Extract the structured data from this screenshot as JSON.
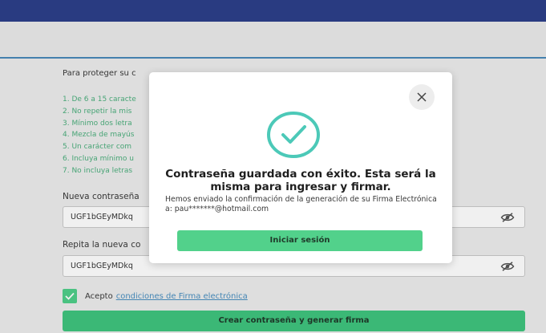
{
  "form": {
    "intro": "Para proteger su c",
    "rules": [
      "1. De 6 a 15 caracte",
      "2. No repetir la mis",
      "3. Mínimo dos letra",
      "4. Mezcla de mayús",
      "5. Un carácter com",
      "6. Incluya mínimo u",
      "7. No incluya letras"
    ],
    "new_password_label": "Nueva contraseña",
    "new_password_value": "UGF1bGEyMDkq",
    "repeat_password_label": "Repita la nueva co",
    "repeat_password_value": "UGF1bGEyMDkq",
    "accept_text": "Acepto",
    "accept_link": "condiciones de Firma electrónica",
    "submit_label": "Crear contraseña y generar firma"
  },
  "modal": {
    "title": "Contraseña guardada con éxito. Esta será la misma para ingresar y firmar.",
    "message": "Hemos enviado la confirmación de la generación de su Firma Electrónica a: pau*******@hotmail.com",
    "button_label": "Iniciar sesión",
    "close_icon": "close-icon",
    "success_icon": "check-circle-icon"
  },
  "colors": {
    "topbar": "#2c3f8a",
    "accent_green": "#3fc47e",
    "rules_green": "#4caf7d",
    "link_blue": "#4a8fc0"
  }
}
